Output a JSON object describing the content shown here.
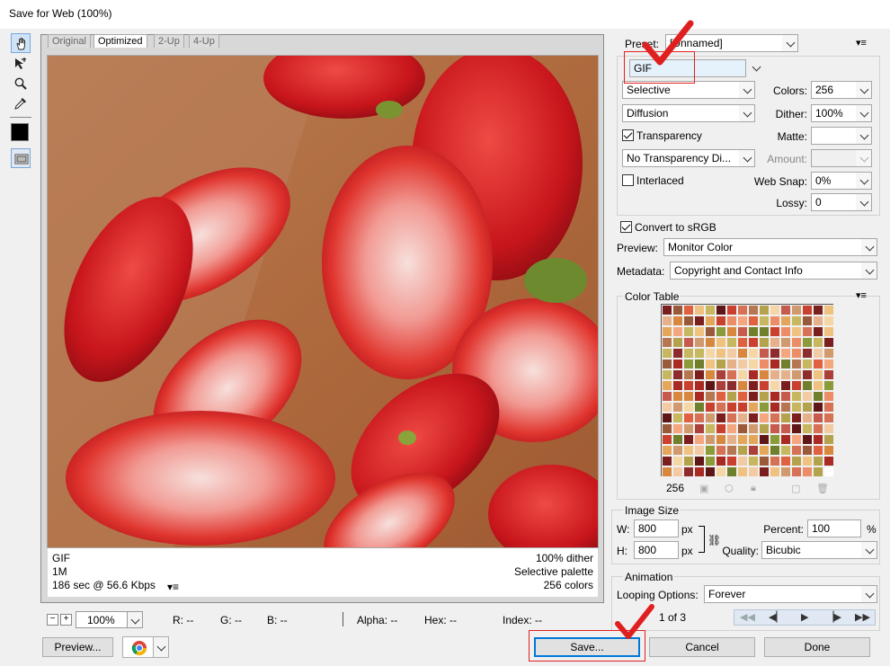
{
  "window": {
    "title": "Save for Web (100%)"
  },
  "tools": [
    "hand-tool",
    "slice-select-tool",
    "zoom-tool",
    "eyedropper-tool"
  ],
  "tabs": [
    {
      "label": "Original"
    },
    {
      "label": "Optimized"
    },
    {
      "label": "2-Up"
    },
    {
      "label": "4-Up"
    }
  ],
  "preview_info": {
    "format": "GIF",
    "size": "1M",
    "time": "186 sec @ 56.6 Kbps",
    "dither": "100% dither",
    "palette": "Selective palette",
    "colors": "256 colors"
  },
  "statusbar": {
    "zoom": "100%",
    "r": "R: --",
    "g": "G: --",
    "b": "B: --",
    "alpha": "Alpha: --",
    "hex": "Hex: --",
    "index": "Index: --"
  },
  "buttons": {
    "preview": "Preview...",
    "save": "Save...",
    "cancel": "Cancel",
    "done": "Done"
  },
  "settings": {
    "preset_label": "Preset:",
    "preset_value": "[Unnamed]",
    "format": "GIF",
    "reduction": "Selective",
    "dither_algo": "Diffusion",
    "transparency_label": "Transparency",
    "transparency_checked": true,
    "transparency_dither": "No Transparency Di...",
    "interlaced_label": "Interlaced",
    "interlaced_checked": false,
    "colors_label": "Colors:",
    "colors_value": "256",
    "dither_label": "Dither:",
    "dither_value": "100%",
    "matte_label": "Matte:",
    "amount_label": "Amount:",
    "websnap_label": "Web Snap:",
    "websnap_value": "0%",
    "lossy_label": "Lossy:",
    "lossy_value": "0",
    "convert_srgb_label": "Convert to sRGB",
    "convert_srgb_checked": true,
    "preview_label": "Preview:",
    "preview_value": "Monitor Color",
    "metadata_label": "Metadata:",
    "metadata_value": "Copyright and Contact Info"
  },
  "color_table": {
    "title": "Color Table",
    "count": "256"
  },
  "image_size": {
    "title": "Image Size",
    "w_label": "W:",
    "w_value": "800",
    "h_label": "H:",
    "h_value": "800",
    "unit": "px",
    "percent_label": "Percent:",
    "percent_value": "100",
    "percent_unit": "%",
    "quality_label": "Quality:",
    "quality_value": "Bicubic"
  },
  "animation": {
    "title": "Animation",
    "looping_label": "Looping Options:",
    "looping_value": "Forever",
    "frame_counter": "1 of 3"
  },
  "colors": {
    "highlight": "#e02020",
    "accent": "#0078d7"
  }
}
